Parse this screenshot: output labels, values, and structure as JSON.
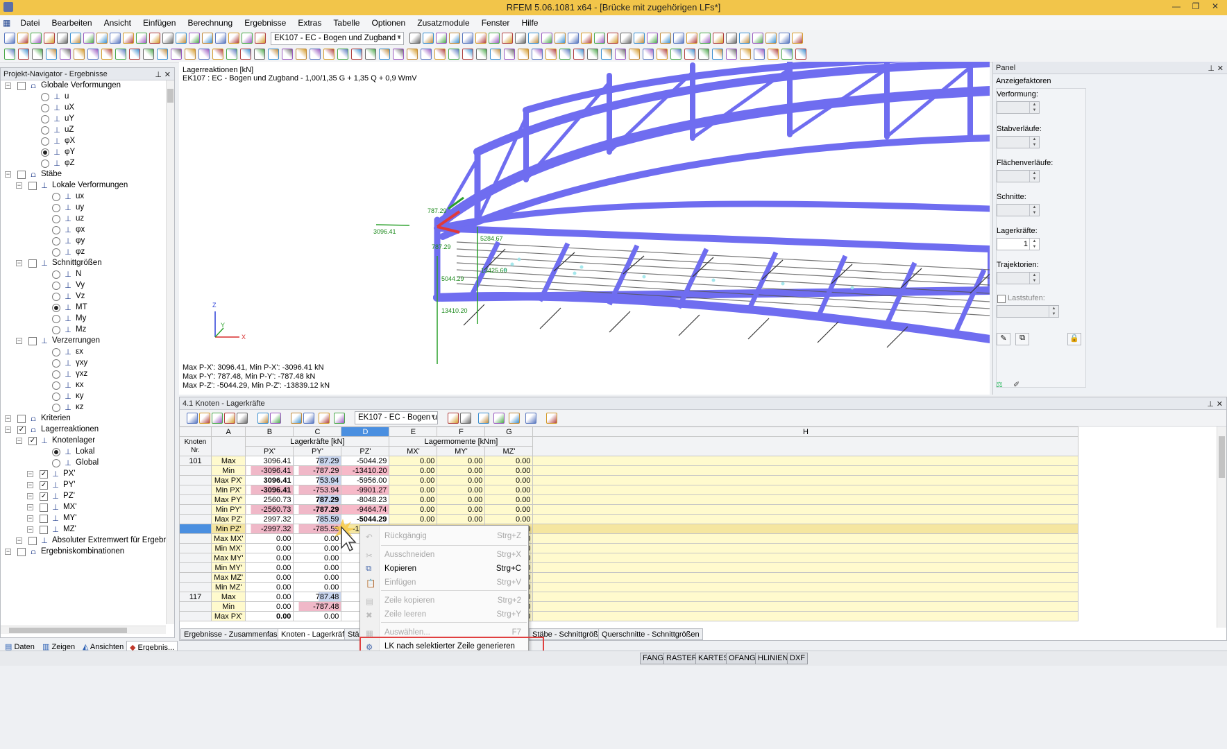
{
  "window": {
    "title": "RFEM 5.06.1081 x64 - [Brücke mit zugehörigen LFs*]"
  },
  "menu": [
    "Datei",
    "Bearbeiten",
    "Ansicht",
    "Einfügen",
    "Berechnung",
    "Ergebnisse",
    "Extras",
    "Tabelle",
    "Optionen",
    "Zusatzmodule",
    "Fenster",
    "Hilfe"
  ],
  "toolbar": {
    "loadcase_combo": "EK107 - EC - Bogen und Zugband - 1,0"
  },
  "navigator": {
    "title": "Projekt-Navigator - Ergebnisse",
    "items": [
      {
        "label": "Globale Verformungen",
        "level": 0
      },
      {
        "label": "u",
        "level": 1,
        "radio": true
      },
      {
        "label": "uX",
        "level": 1,
        "radio": true
      },
      {
        "label": "uY",
        "level": 1,
        "radio": true
      },
      {
        "label": "uZ",
        "level": 1,
        "radio": true
      },
      {
        "label": "φX",
        "level": 1,
        "radio": true
      },
      {
        "label": "φY",
        "level": 1,
        "radio": true,
        "on": true
      },
      {
        "label": "φZ",
        "level": 1,
        "radio": true
      },
      {
        "label": "Stäbe",
        "level": 0
      },
      {
        "label": "Lokale Verformungen",
        "level": 1
      },
      {
        "label": "ux",
        "level": 2,
        "radio": true
      },
      {
        "label": "uy",
        "level": 2,
        "radio": true
      },
      {
        "label": "uz",
        "level": 2,
        "radio": true
      },
      {
        "label": "φx",
        "level": 2,
        "radio": true
      },
      {
        "label": "φy",
        "level": 2,
        "radio": true
      },
      {
        "label": "φz",
        "level": 2,
        "radio": true
      },
      {
        "label": "Schnittgrößen",
        "level": 1
      },
      {
        "label": "N",
        "level": 2,
        "radio": true
      },
      {
        "label": "Vy",
        "level": 2,
        "radio": true
      },
      {
        "label": "Vz",
        "level": 2,
        "radio": true
      },
      {
        "label": "MT",
        "level": 2,
        "radio": true,
        "on": true
      },
      {
        "label": "My",
        "level": 2,
        "radio": true
      },
      {
        "label": "Mz",
        "level": 2,
        "radio": true
      },
      {
        "label": "Verzerrungen",
        "level": 1
      },
      {
        "label": "εx",
        "level": 2,
        "radio": true
      },
      {
        "label": "γxy",
        "level": 2,
        "radio": true
      },
      {
        "label": "γxz",
        "level": 2,
        "radio": true
      },
      {
        "label": "κx",
        "level": 2,
        "radio": true
      },
      {
        "label": "κy",
        "level": 2,
        "radio": true
      },
      {
        "label": "κz",
        "level": 2,
        "radio": true
      },
      {
        "label": "Kriterien",
        "level": 0
      },
      {
        "label": "Lagerreaktionen",
        "level": 0,
        "checked": true
      },
      {
        "label": "Knotenlager",
        "level": 1,
        "checked": true
      },
      {
        "label": "Lokal",
        "level": 2,
        "radio": true,
        "on": true
      },
      {
        "label": "Global",
        "level": 2,
        "radio": true
      },
      {
        "label": "PX'",
        "level": 2,
        "checked": true
      },
      {
        "label": "PY'",
        "level": 2,
        "checked": true
      },
      {
        "label": "PZ'",
        "level": 2,
        "checked": true
      },
      {
        "label": "MX'",
        "level": 2
      },
      {
        "label": "MY'",
        "level": 2
      },
      {
        "label": "MZ'",
        "level": 2
      },
      {
        "label": "Absoluter Extremwert für Ergebnis",
        "level": 1
      },
      {
        "label": "Ergebniskombinationen",
        "level": 0
      }
    ],
    "tabs": [
      "Daten",
      "Zeigen",
      "Ansichten",
      "Ergebnis..."
    ]
  },
  "view": {
    "header1": "Lagerreaktionen [kN]",
    "header2": "EK107 : EC - Bogen und Zugband - 1,00/1,35 G + 1,35 Q + 0,9 WmV",
    "labels": [
      "3096.41",
      "787.29",
      "787.29",
      "5284.67",
      "5044.29",
      "13425.60",
      "13410.20"
    ],
    "axes": [
      "Z",
      "Y",
      "X"
    ],
    "footer": [
      "Max P-X': 3096.41, Min P-X': -3096.41 kN",
      "Max P-Y': 787.48, Min P-Y': -787.48 kN",
      "Max P-Z': -5044.29, Min P-Z': -13839.12 kN"
    ]
  },
  "panel": {
    "title": "Panel",
    "section": "Anzeigefaktoren",
    "fields": [
      "Verformung:",
      "Stabverläufe:",
      "Flächenverläufe:",
      "Schnitte:",
      "Lagerkräfte:",
      "Trajektorien:",
      "Laststufen:"
    ],
    "lagerkraefte_value": "1"
  },
  "table": {
    "title": "4.1 Knoten - Lagerkräfte",
    "combo": "EK107 - EC - Bogen un",
    "col_letters": [
      "A",
      "B",
      "C",
      "D",
      "E",
      "F",
      "G",
      "H"
    ],
    "knoten_header": "Knoten Nr.",
    "group1": "Lagerkräfte [kN]",
    "group2": "Lagermomente [kNm]",
    "sub": [
      "PX'",
      "PY'",
      "PZ'",
      "MX'",
      "MY'",
      "MZ'"
    ],
    "rows": [
      {
        "n": "101",
        "t": "Max",
        "v": [
          "3096.41",
          "787.29",
          "-5044.29",
          "0.00",
          "0.00",
          "0.00"
        ]
      },
      {
        "n": "",
        "t": "Min",
        "v": [
          "-3096.41",
          "-787.29",
          "-13410.20",
          "0.00",
          "0.00",
          "0.00"
        ]
      },
      {
        "n": "",
        "t": "Max PX'",
        "v": [
          "3096.41",
          "753.94",
          "-5956.00",
          "0.00",
          "0.00",
          "0.00"
        ]
      },
      {
        "n": "",
        "t": "Min PX'",
        "v": [
          "-3096.41",
          "-753.94",
          "-9901.27",
          "0.00",
          "0.00",
          "0.00"
        ]
      },
      {
        "n": "",
        "t": "Max PY'",
        "v": [
          "2560.73",
          "787.29",
          "-8048.23",
          "0.00",
          "0.00",
          "0.00"
        ]
      },
      {
        "n": "",
        "t": "Min PY'",
        "v": [
          "-2560.73",
          "-787.29",
          "-9464.74",
          "0.00",
          "0.00",
          "0.00"
        ]
      },
      {
        "n": "",
        "t": "Max PZ'",
        "v": [
          "2997.32",
          "785.59",
          "-5044.29",
          "0.00",
          "0.00",
          "0.00"
        ]
      },
      {
        "n": "",
        "t": "Min PZ'",
        "v": [
          "-2997.32",
          "-785.59",
          "-13410.20",
          "0.00",
          "0.00",
          "0.00"
        ]
      },
      {
        "n": "",
        "t": "Max MX'",
        "v": [
          "0.00",
          "0.00",
          "-5",
          "0.00",
          "0.00",
          "0.00"
        ]
      },
      {
        "n": "",
        "t": "Min MX'",
        "v": [
          "0.00",
          "0.00",
          "-5",
          "0.00",
          "0.00",
          "0.00"
        ]
      },
      {
        "n": "",
        "t": "Max MY'",
        "v": [
          "0.00",
          "0.00",
          "-5",
          "0.00",
          "0.00",
          "0.00"
        ]
      },
      {
        "n": "",
        "t": "Min MY'",
        "v": [
          "0.00",
          "0.00",
          "-5",
          "0.00",
          "0.00",
          "0.00"
        ]
      },
      {
        "n": "",
        "t": "Max MZ'",
        "v": [
          "0.00",
          "0.00",
          "-5",
          "0.00",
          "0.00",
          "0.00"
        ]
      },
      {
        "n": "",
        "t": "Min MZ'",
        "v": [
          "0.00",
          "0.00",
          "-5",
          "0.00",
          "0.00",
          "0.00"
        ]
      },
      {
        "n": "117",
        "t": "Max",
        "v": [
          "0.00",
          "787.48",
          "-5",
          "0.00",
          "0.00",
          "0.00"
        ]
      },
      {
        "n": "",
        "t": "Min",
        "v": [
          "0.00",
          "-787.48",
          "-13",
          "0.00",
          "0.00",
          "0.00"
        ]
      },
      {
        "n": "",
        "t": "Max PX'",
        "v": [
          "0.00",
          "0.00",
          "-6",
          "0.00",
          "0.00",
          "0.00"
        ]
      }
    ],
    "tabs": [
      "Ergebnisse - Zusammenfassung",
      "Knoten - Lagerkräfte",
      "Stäbe",
      "Stäbe - Schnittgrößen",
      "Querschnitte - Schnittgrößen"
    ]
  },
  "context_menu": [
    {
      "label": "Rückgängig",
      "key": "Strg+Z",
      "disabled": true
    },
    {
      "label": "Ausschneiden",
      "key": "Strg+X",
      "disabled": true
    },
    {
      "label": "Kopieren",
      "key": "Strg+C"
    },
    {
      "label": "Einfügen",
      "key": "Strg+V",
      "disabled": true
    },
    {
      "label": "Zeile kopieren",
      "key": "Strg+2",
      "disabled": true
    },
    {
      "label": "Zeile leeren",
      "key": "Strg+Y",
      "disabled": true
    },
    {
      "label": "Auswählen...",
      "key": "F7",
      "disabled": true
    },
    {
      "label": "LK nach selektierter Zeile generieren",
      "key": ""
    }
  ],
  "statusbar": [
    "FANG",
    "RASTER",
    "KARTES",
    "OFANG",
    "HLINIEN",
    "DXF"
  ],
  "colors": {
    "structure": "#6f6df0",
    "highlight": "#e05858",
    "title": "#f2c54a"
  }
}
